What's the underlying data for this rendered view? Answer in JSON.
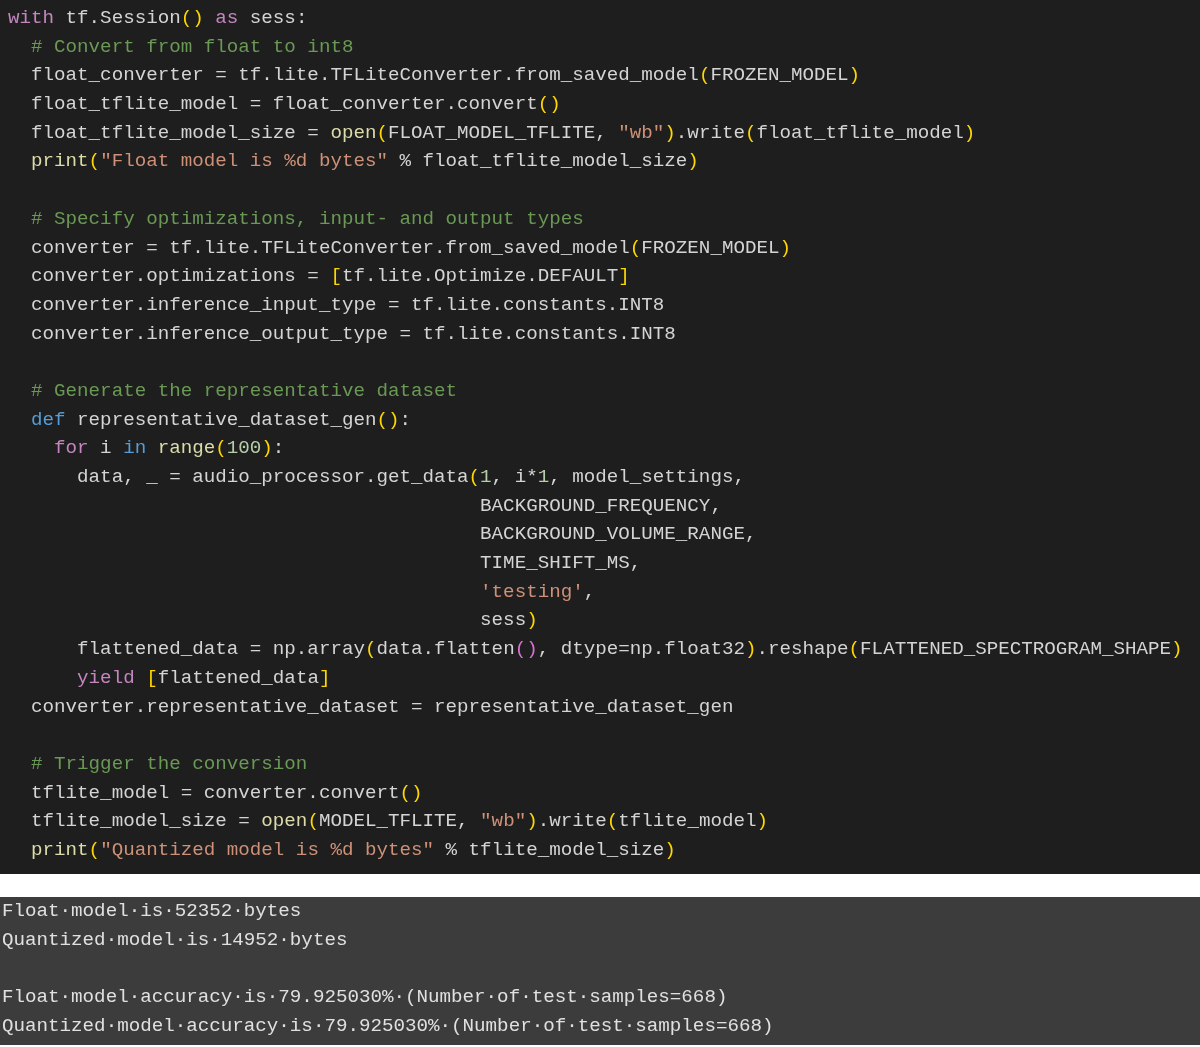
{
  "editor": {
    "lines": [
      {
        "kind": "code",
        "tokens": [
          {
            "kind": "kw",
            "text": "with"
          },
          {
            "kind": "tx",
            "text": " tf.Session"
          },
          {
            "kind": "b1",
            "text": "()"
          },
          {
            "kind": "kw",
            "text": " as"
          },
          {
            "kind": "tx",
            "text": " sess:"
          }
        ]
      },
      {
        "kind": "code",
        "tokens": [
          {
            "kind": "cm",
            "text": "  # Convert from float to int8"
          }
        ]
      },
      {
        "kind": "code",
        "tokens": [
          {
            "kind": "tx",
            "text": "  float_converter = tf.lite.TFLiteConverter.from_saved_model"
          },
          {
            "kind": "b1",
            "text": "("
          },
          {
            "kind": "tx",
            "text": "FROZEN_MODEL"
          },
          {
            "kind": "b1",
            "text": ")"
          }
        ]
      },
      {
        "kind": "code",
        "tokens": [
          {
            "kind": "tx",
            "text": "  float_tflite_model = float_converter.convert"
          },
          {
            "kind": "b1",
            "text": "()"
          }
        ]
      },
      {
        "kind": "code",
        "tokens": [
          {
            "kind": "tx",
            "text": "  float_tflite_model_size = "
          },
          {
            "kind": "fn",
            "text": "open"
          },
          {
            "kind": "b1",
            "text": "("
          },
          {
            "kind": "tx",
            "text": "FLOAT_MODEL_TFLITE, "
          },
          {
            "kind": "str",
            "text": "\"wb\""
          },
          {
            "kind": "b1",
            "text": ")"
          },
          {
            "kind": "tx",
            "text": ".write"
          },
          {
            "kind": "b1",
            "text": "("
          },
          {
            "kind": "tx",
            "text": "float_tflite_model"
          },
          {
            "kind": "b1",
            "text": ")"
          }
        ]
      },
      {
        "kind": "code",
        "tokens": [
          {
            "kind": "fn",
            "text": "  print"
          },
          {
            "kind": "b1",
            "text": "("
          },
          {
            "kind": "str",
            "text": "\"Float model is %d bytes\""
          },
          {
            "kind": "tx",
            "text": " % float_tflite_model_size"
          },
          {
            "kind": "b1",
            "text": ")"
          }
        ]
      },
      {
        "kind": "blank"
      },
      {
        "kind": "code",
        "tokens": [
          {
            "kind": "cm",
            "text": "  # Specify optimizations, input- and output types"
          }
        ]
      },
      {
        "kind": "code",
        "tokens": [
          {
            "kind": "tx",
            "text": "  converter = tf.lite.TFLiteConverter.from_saved_model"
          },
          {
            "kind": "b1",
            "text": "("
          },
          {
            "kind": "tx",
            "text": "FROZEN_MODEL"
          },
          {
            "kind": "b1",
            "text": ")"
          }
        ]
      },
      {
        "kind": "code",
        "tokens": [
          {
            "kind": "tx",
            "text": "  converter.optimizations = "
          },
          {
            "kind": "b1",
            "text": "["
          },
          {
            "kind": "tx",
            "text": "tf.lite.Optimize.DEFAULT"
          },
          {
            "kind": "b1",
            "text": "]"
          }
        ]
      },
      {
        "kind": "code",
        "tokens": [
          {
            "kind": "tx",
            "text": "  converter.inference_input_type = tf.lite.constants.INT8"
          }
        ]
      },
      {
        "kind": "code",
        "tokens": [
          {
            "kind": "tx",
            "text": "  converter.inference_output_type = tf.lite.constants.INT8"
          }
        ]
      },
      {
        "kind": "blank"
      },
      {
        "kind": "code",
        "tokens": [
          {
            "kind": "cm",
            "text": "  # Generate the representative dataset"
          }
        ]
      },
      {
        "kind": "code",
        "tokens": [
          {
            "kind": "def",
            "text": "  def"
          },
          {
            "kind": "tx",
            "text": " representative_dataset_gen"
          },
          {
            "kind": "b1",
            "text": "()"
          },
          {
            "kind": "tx",
            "text": ":"
          }
        ]
      },
      {
        "kind": "code",
        "tokens": [
          {
            "kind": "kw",
            "text": "    for"
          },
          {
            "kind": "tx",
            "text": " i "
          },
          {
            "kind": "def",
            "text": "in"
          },
          {
            "kind": "fn",
            "text": " range"
          },
          {
            "kind": "b1",
            "text": "("
          },
          {
            "kind": "num",
            "text": "100"
          },
          {
            "kind": "b1",
            "text": ")"
          },
          {
            "kind": "tx",
            "text": ":"
          }
        ]
      },
      {
        "kind": "code",
        "tokens": [
          {
            "kind": "tx",
            "text": "      data, _ = audio_processor.get_data"
          },
          {
            "kind": "b1",
            "text": "("
          },
          {
            "kind": "num",
            "text": "1"
          },
          {
            "kind": "tx",
            "text": ", i*"
          },
          {
            "kind": "num",
            "text": "1"
          },
          {
            "kind": "tx",
            "text": ", model_settings,"
          }
        ]
      },
      {
        "kind": "code",
        "tokens": [
          {
            "kind": "tx",
            "text": "                                         BACKGROUND_FREQUENCY,"
          }
        ]
      },
      {
        "kind": "code",
        "tokens": [
          {
            "kind": "tx",
            "text": "                                         BACKGROUND_VOLUME_RANGE,"
          }
        ]
      },
      {
        "kind": "code",
        "tokens": [
          {
            "kind": "tx",
            "text": "                                         TIME_SHIFT_MS,"
          }
        ]
      },
      {
        "kind": "code",
        "tokens": [
          {
            "kind": "str",
            "text": "                                         'testing'"
          },
          {
            "kind": "tx",
            "text": ","
          }
        ]
      },
      {
        "kind": "code",
        "tokens": [
          {
            "kind": "tx",
            "text": "                                         sess"
          },
          {
            "kind": "b1",
            "text": ")"
          }
        ]
      },
      {
        "kind": "code",
        "tokens": [
          {
            "kind": "tx",
            "text": "      flattened_data = np.array"
          },
          {
            "kind": "b1",
            "text": "("
          },
          {
            "kind": "tx",
            "text": "data.flatten"
          },
          {
            "kind": "b2",
            "text": "()"
          },
          {
            "kind": "tx",
            "text": ", dtype=np.float32"
          },
          {
            "kind": "b1",
            "text": ")"
          },
          {
            "kind": "tx",
            "text": ".reshape"
          },
          {
            "kind": "b1",
            "text": "("
          },
          {
            "kind": "tx",
            "text": "FLATTENED_SPECTROGRAM_SHAPE"
          },
          {
            "kind": "b1",
            "text": ")"
          }
        ]
      },
      {
        "kind": "code",
        "tokens": [
          {
            "kind": "kw",
            "text": "      yield"
          },
          {
            "kind": "b1",
            "text": " ["
          },
          {
            "kind": "tx",
            "text": "flattened_data"
          },
          {
            "kind": "b1",
            "text": "]"
          }
        ]
      },
      {
        "kind": "code",
        "tokens": [
          {
            "kind": "tx",
            "text": "  converter.representative_dataset = representative_dataset_gen"
          }
        ]
      },
      {
        "kind": "blank"
      },
      {
        "kind": "code",
        "tokens": [
          {
            "kind": "cm",
            "text": "  # Trigger the conversion"
          }
        ]
      },
      {
        "kind": "code",
        "tokens": [
          {
            "kind": "tx",
            "text": "  tflite_model = converter.convert"
          },
          {
            "kind": "b1",
            "text": "()"
          }
        ]
      },
      {
        "kind": "code",
        "tokens": [
          {
            "kind": "tx",
            "text": "  tflite_model_size = "
          },
          {
            "kind": "fn",
            "text": "open"
          },
          {
            "kind": "b1",
            "text": "("
          },
          {
            "kind": "tx",
            "text": "MODEL_TFLITE, "
          },
          {
            "kind": "str",
            "text": "\"wb\""
          },
          {
            "kind": "b1",
            "text": ")"
          },
          {
            "kind": "tx",
            "text": ".write"
          },
          {
            "kind": "b1",
            "text": "("
          },
          {
            "kind": "tx",
            "text": "tflite_model"
          },
          {
            "kind": "b1",
            "text": ")"
          }
        ]
      },
      {
        "kind": "code",
        "tokens": [
          {
            "kind": "fn",
            "text": "  print"
          },
          {
            "kind": "b1",
            "text": "("
          },
          {
            "kind": "str",
            "text": "\"Quantized model is %d bytes\""
          },
          {
            "kind": "tx",
            "text": " % tflite_model_size"
          },
          {
            "kind": "b1",
            "text": ")"
          }
        ]
      }
    ]
  },
  "output": {
    "lines": [
      {
        "kind": "text",
        "text": "Float·model·is·52352·bytes"
      },
      {
        "kind": "text",
        "text": "Quantized·model·is·14952·bytes"
      },
      {
        "kind": "blank"
      },
      {
        "kind": "text",
        "text": "Float·model·accuracy·is·79.925030%·(Number·of·test·samples=668)"
      },
      {
        "kind": "text",
        "text": "Quantized·model·accuracy·is·79.925030%·(Number·of·test·samples=668)"
      }
    ]
  }
}
